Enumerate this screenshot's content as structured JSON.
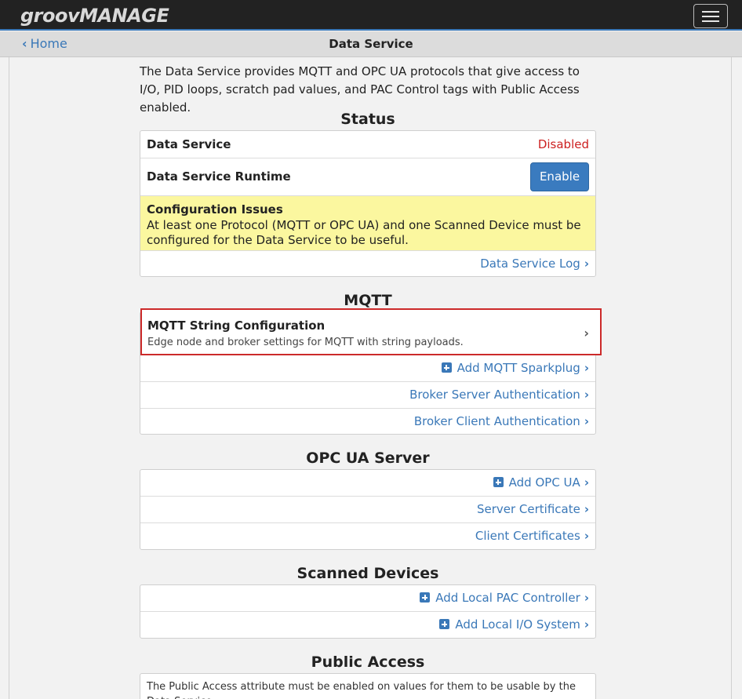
{
  "header": {
    "logo_groov": "groov",
    "logo_manage": "MANAGE"
  },
  "nav": {
    "home_label": "Home",
    "page_title": "Data Service"
  },
  "intro": "The Data Service provides MQTT and OPC UA protocols that give access to I/O, PID loops, scratch pad values, and PAC Control tags with Public Access enabled.",
  "status": {
    "title": "Status",
    "data_service_label": "Data Service",
    "data_service_value": "Disabled",
    "runtime_label": "Data Service Runtime",
    "enable_button": "Enable",
    "issues_title": "Configuration Issues",
    "issues_text": "At least one Protocol (MQTT or OPC UA) and one Scanned Device must be configured for the Data Service to be useful.",
    "log_link": "Data Service Log"
  },
  "mqtt": {
    "title": "MQTT",
    "string_config_title": "MQTT String Configuration",
    "string_config_desc": "Edge node and broker settings for MQTT with string payloads.",
    "add_sparkplug": "Add MQTT Sparkplug",
    "broker_server_auth": "Broker Server Authentication",
    "broker_client_auth": "Broker Client Authentication"
  },
  "opcua": {
    "title": "OPC UA Server",
    "add_opcua": "Add OPC UA",
    "server_cert": "Server Certificate",
    "client_certs": "Client Certificates"
  },
  "scanned": {
    "title": "Scanned Devices",
    "add_pac": "Add Local PAC Controller",
    "add_io": "Add Local I/O System"
  },
  "public_access": {
    "title": "Public Access",
    "text": "The Public Access attribute must be enabled on values for them to be usable by the Data Service."
  },
  "colors": {
    "accent": "#3a78b8",
    "disabled_red": "#cc1f1f",
    "warning_bg": "#fbf79f",
    "highlight_border": "#cc2a2a"
  }
}
